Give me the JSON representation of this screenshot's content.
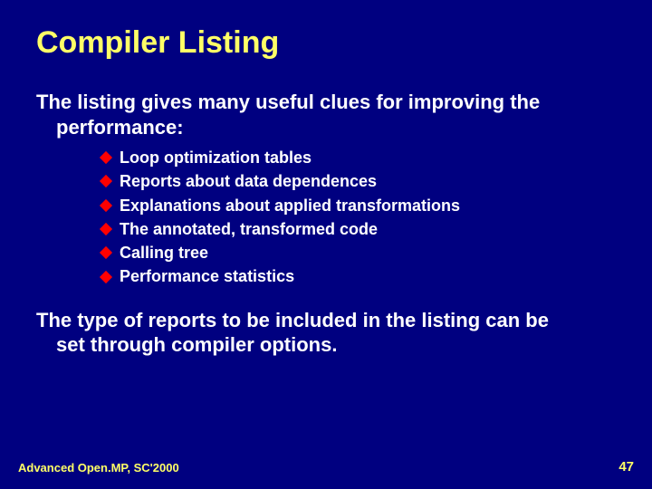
{
  "slide": {
    "title": "Compiler Listing",
    "intro_line1": "The listing gives many useful clues for improving the",
    "intro_line2": "performance:",
    "bullets": [
      "Loop optimization tables",
      "Reports about data dependences",
      "Explanations about applied transformations",
      "The annotated, transformed code",
      "Calling tree",
      "Performance statistics"
    ],
    "closing_line1": "The type of reports to be included in the listing can be",
    "closing_line2": "set through compiler options.",
    "footer_left": "Advanced Open.MP, SC'2000",
    "footer_right": "47"
  }
}
